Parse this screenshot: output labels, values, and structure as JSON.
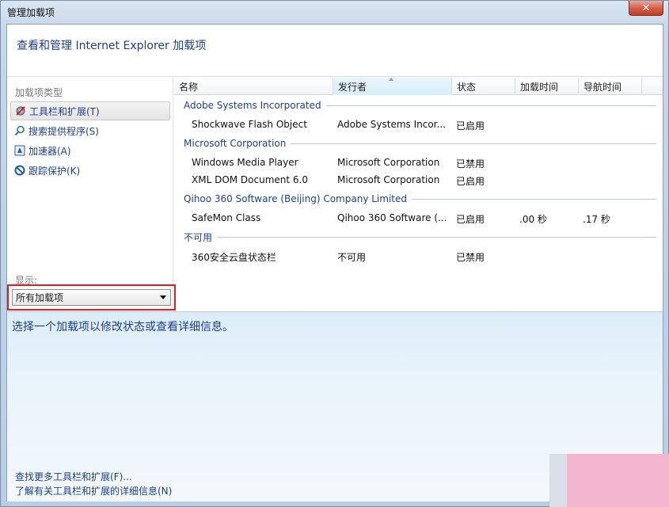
{
  "window": {
    "title": "管理加载项",
    "close_label": "✕"
  },
  "header": {
    "title": "查看和管理 Internet Explorer 加载项"
  },
  "sidebar": {
    "category_label": "加载项类型",
    "items": [
      {
        "label": "工具栏和扩展(T)",
        "icon": "gear-icon"
      },
      {
        "label": "搜索提供程序(S)",
        "icon": "search-icon"
      },
      {
        "label": "加速器(A)",
        "icon": "accelerator-icon"
      },
      {
        "label": "跟踪保护(K)",
        "icon": "block-icon"
      }
    ],
    "show_label": "显示:",
    "show_value": "所有加载项"
  },
  "table": {
    "columns": [
      "名称",
      "发行者",
      "状态",
      "加载时间",
      "导航时间"
    ],
    "groups": [
      {
        "name": "Adobe Systems Incorporated",
        "rows": [
          {
            "name": "Shockwave Flash Object",
            "publisher": "Adobe Systems Incor...",
            "status": "已启用",
            "load_time": "",
            "nav_time": ""
          }
        ]
      },
      {
        "name": "Microsoft Corporation",
        "rows": [
          {
            "name": "Windows Media Player",
            "publisher": "Microsoft Corporation",
            "status": "已禁用",
            "load_time": "",
            "nav_time": ""
          },
          {
            "name": "XML DOM Document 6.0",
            "publisher": "Microsoft Corporation",
            "status": "已启用",
            "load_time": "",
            "nav_time": ""
          }
        ]
      },
      {
        "name": "Qihoo 360 Software (Beijing) Company Limited",
        "rows": [
          {
            "name": "SafeMon Class",
            "publisher": "Qihoo 360 Software (...",
            "status": "已启用",
            "load_time": ".00 秒",
            "nav_time": ".17 秒"
          }
        ]
      },
      {
        "name": "不可用",
        "rows": [
          {
            "name": "360安全云盘状态栏",
            "publisher": "不可用",
            "status": "已禁用",
            "load_time": "",
            "nav_time": ""
          }
        ]
      }
    ]
  },
  "detail": {
    "message": "选择一个加载项以修改状态或查看详细信息。"
  },
  "footer": {
    "link_find_more": "查找更多工具栏和扩展(F)...",
    "link_learn_more": "了解有关工具栏和扩展的详细信息(N)"
  },
  "colors": {
    "accent_text": "#1e3f8e",
    "highlight_border": "#e02020"
  }
}
